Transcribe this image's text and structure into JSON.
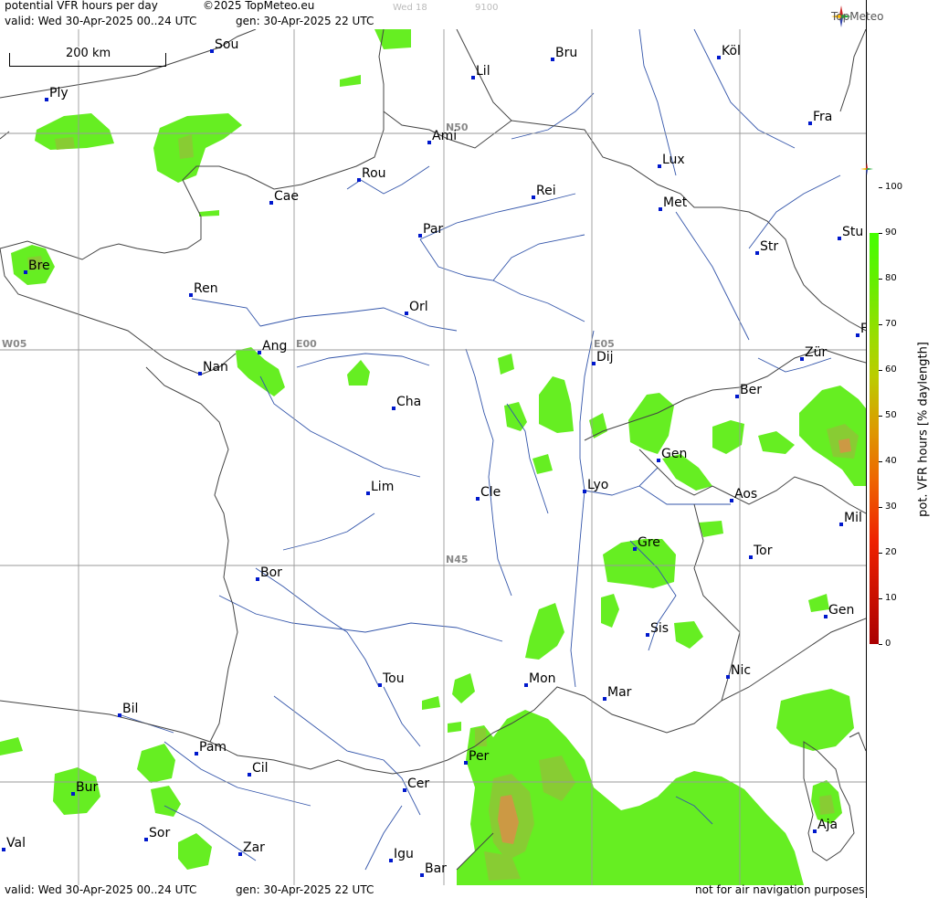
{
  "header": {
    "title": "potential VFR hours per day",
    "copyright": "©2025 TopMeteo.eu",
    "day_code": "Wed 18",
    "run_code": "9100",
    "valid": "valid:  Wed  30-Apr-2025  00..24 UTC",
    "generated": "gen: 30-Apr-2025 22 UTC",
    "logo_text": "TopMeteo"
  },
  "scale": {
    "label": "200 km"
  },
  "grid_labels": {
    "n50": "N50",
    "n45": "N45",
    "w05": "W05",
    "e00": "E00",
    "e05": "E05"
  },
  "cities": [
    {
      "name": "Sou"
    },
    {
      "name": "Bru"
    },
    {
      "name": "Köl"
    },
    {
      "name": "Lil"
    },
    {
      "name": "Ply"
    },
    {
      "name": "Ami"
    },
    {
      "name": "Fra"
    },
    {
      "name": "Lux"
    },
    {
      "name": "Rou"
    },
    {
      "name": "Cae"
    },
    {
      "name": "Rei"
    },
    {
      "name": "Met"
    },
    {
      "name": "Par"
    },
    {
      "name": "Bre"
    },
    {
      "name": "Stu"
    },
    {
      "name": "Str"
    },
    {
      "name": "Ren"
    },
    {
      "name": "Orl"
    },
    {
      "name": "Ang"
    },
    {
      "name": "Nan"
    },
    {
      "name": "Dij"
    },
    {
      "name": "Zür"
    },
    {
      "name": "Ber"
    },
    {
      "name": "Cha"
    },
    {
      "name": "Gen"
    },
    {
      "name": "Lim"
    },
    {
      "name": "Cle"
    },
    {
      "name": "Lyo"
    },
    {
      "name": "Aos"
    },
    {
      "name": "Mil"
    },
    {
      "name": "Bor"
    },
    {
      "name": "Gre"
    },
    {
      "name": "Tor"
    },
    {
      "name": "Gen"
    },
    {
      "name": "Sis"
    },
    {
      "name": "Tou"
    },
    {
      "name": "Mon"
    },
    {
      "name": "Mar"
    },
    {
      "name": "Nic"
    },
    {
      "name": "Bil"
    },
    {
      "name": "Per"
    },
    {
      "name": "Pam"
    },
    {
      "name": "Cil"
    },
    {
      "name": "Bur"
    },
    {
      "name": "Cer"
    },
    {
      "name": "Sor"
    },
    {
      "name": "Val"
    },
    {
      "name": "Zar"
    },
    {
      "name": "Igu"
    },
    {
      "name": "Bar"
    },
    {
      "name": "Aja"
    },
    {
      "name": "F"
    }
  ],
  "footer": {
    "valid": "valid:  Wed  30-Apr-2025  00..24 UTC",
    "generated": "gen: 30-Apr-2025 22 UTC",
    "disclaimer": "not for air navigation purposes"
  },
  "legend": {
    "title": "pot. VFR hours [% daylength]",
    "ticks": [
      "100",
      "90",
      "80",
      "70",
      "60",
      "50",
      "40",
      "30",
      "20",
      "10",
      "0"
    ]
  },
  "colors": {
    "vfr_green": "#66ee22",
    "vfr_mid": "#88cc33",
    "vfr_orange": "#cc9944",
    "river": "#3355aa",
    "border": "#444444",
    "grid": "#999999",
    "city_dot": "#0018cc"
  }
}
